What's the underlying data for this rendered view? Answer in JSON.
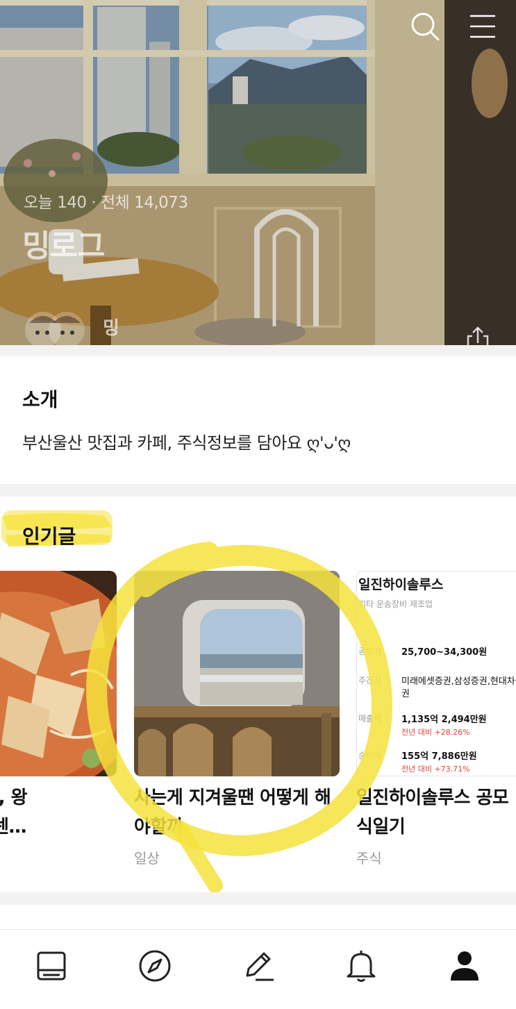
{
  "hero": {
    "stats": "오늘 140 · 전체 14,073",
    "title": "밍로그",
    "nickname": "밍"
  },
  "intro": {
    "heading": "소개",
    "text": "부산울산 맛집과 카페, 주식정보를 담아요 ღ'ᴗ'ღ"
  },
  "popular": {
    "heading": "인기글",
    "cards": [
      {
        "title_line1": "이 마라탕집, 왕",
        "title_line2": "신세계부산센…",
        "category": ""
      },
      {
        "title_line1": "사는게 지겨울땐 어떻게 해",
        "title_line2": "야할까",
        "category": "일상"
      },
      {
        "title_line1": "일진하이솔루스 공모",
        "title_line2": "식일기",
        "category": "주식"
      }
    ],
    "stock_card": {
      "name": "일진하이솔루스",
      "sector": "기타 운송장비 제조업",
      "rows": [
        {
          "label": "공모가",
          "value": "25,700~34,300원",
          "change": ""
        },
        {
          "label": "주간사",
          "value": "미래에셋증권,삼성증권,현대차증",
          "value2": "권",
          "change": ""
        },
        {
          "label": "매출액",
          "value": "1,135억 2,494만원",
          "change": "전년 대비 +28.26%"
        },
        {
          "label": "순이익",
          "value": "155억 7,886만원",
          "change": "전년 대비 +73.71%"
        }
      ]
    }
  },
  "icons": {
    "top": [
      "search-icon",
      "menu-icon"
    ],
    "nav": [
      "feed-icon",
      "compass-icon",
      "pencil-icon",
      "bell-icon",
      "person-icon"
    ]
  },
  "colors": {
    "highlight": "#f5e23c",
    "accent_red": "#e0423d"
  }
}
